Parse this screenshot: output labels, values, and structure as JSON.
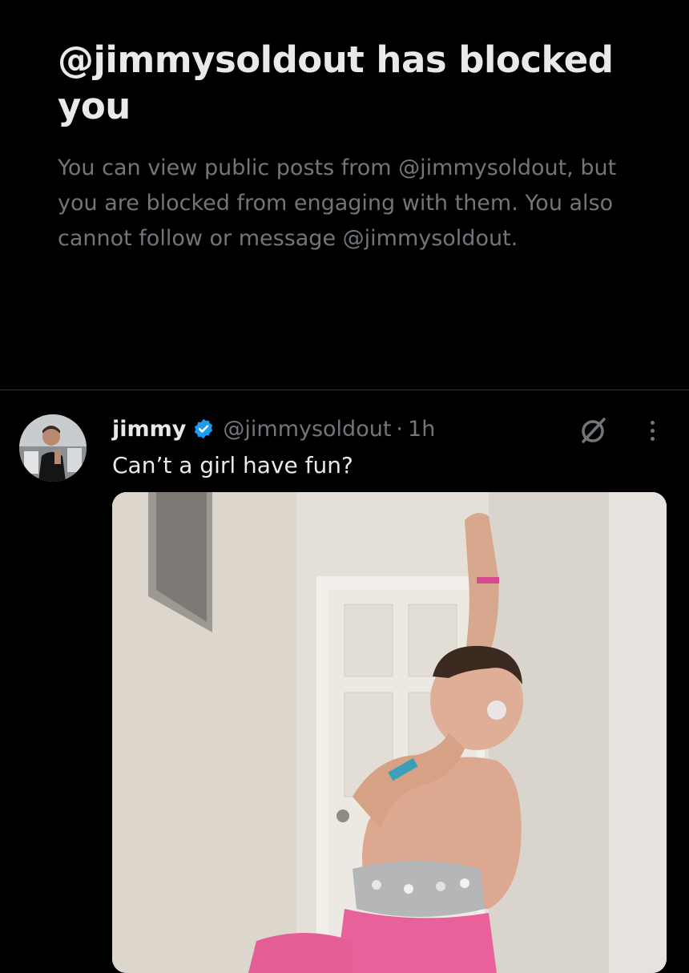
{
  "block_notice": {
    "title": "@jimmysoldout has blocked you",
    "description": "You can view public posts from @jimmysoldout, but you are blocked from engaging with them. You also cannot follow or message @jimmysoldout."
  },
  "post": {
    "author_name": "jimmy",
    "handle": "@jimmysoldout",
    "separator": "·",
    "time": "1h",
    "text": "Can’t a girl have fun?",
    "verified": true,
    "icons": {
      "verified": "verified-badge-icon",
      "grok": "grok-icon",
      "more": "more-options-icon"
    }
  },
  "colors": {
    "background": "#000000",
    "primary_text": "#e7e9ea",
    "secondary_text": "#71767b",
    "divider": "#2f3336",
    "verified_blue": "#1d9bf0"
  }
}
